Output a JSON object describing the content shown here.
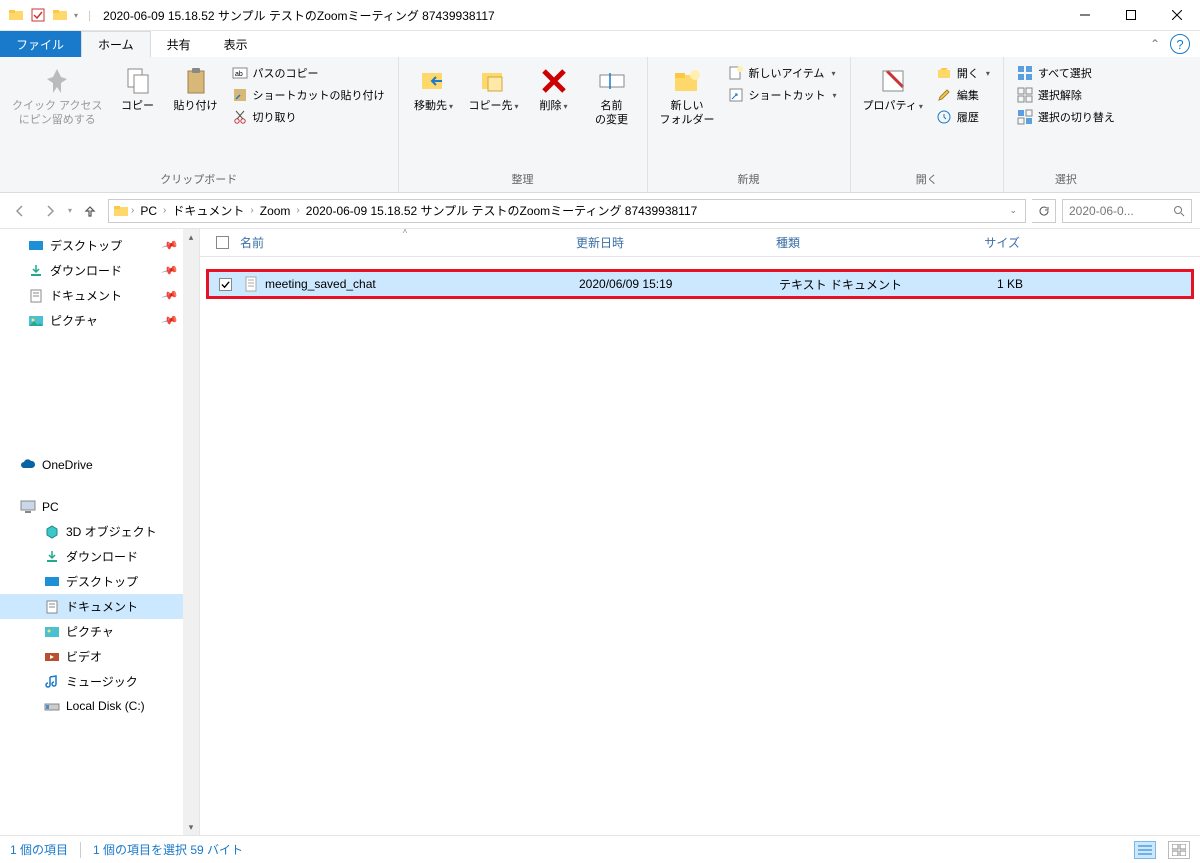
{
  "window": {
    "title": "2020-06-09 15.18.52 サンプル テストのZoomミーティング 87439938117"
  },
  "tabs": {
    "file": "ファイル",
    "home": "ホーム",
    "share": "共有",
    "view": "表示"
  },
  "ribbon": {
    "clipboard": {
      "quick_access": "クイック アクセス\nにピン留めする",
      "copy": "コピー",
      "paste": "貼り付け",
      "copy_path": "パスのコピー",
      "paste_shortcut": "ショートカットの貼り付け",
      "cut": "切り取り",
      "label": "クリップボード"
    },
    "organize": {
      "move_to": "移動先",
      "copy_to": "コピー先",
      "delete": "削除",
      "rename": "名前\nの変更",
      "label": "整理"
    },
    "new": {
      "new_folder": "新しい\nフォルダー",
      "new_item": "新しいアイテム",
      "shortcut": "ショートカット",
      "label": "新規"
    },
    "open": {
      "properties": "プロパティ",
      "open": "開く",
      "edit": "編集",
      "history": "履歴",
      "label": "開く"
    },
    "select": {
      "select_all": "すべて選択",
      "select_none": "選択解除",
      "invert": "選択の切り替え",
      "label": "選択"
    }
  },
  "breadcrumb": {
    "pc": "PC",
    "documents": "ドキュメント",
    "zoom": "Zoom",
    "folder": "2020-06-09 15.18.52 サンプル テストのZoomミーティング 87439938117"
  },
  "search": {
    "placeholder": "2020-06-0..."
  },
  "sidebar": {
    "quick": {
      "desktop": "デスクトップ",
      "downloads": "ダウンロード",
      "documents": "ドキュメント",
      "pictures": "ピクチャ"
    },
    "onedrive": "OneDrive",
    "pc": "PC",
    "pc_children": {
      "objects3d": "3D オブジェクト",
      "downloads": "ダウンロード",
      "desktop": "デスクトップ",
      "documents": "ドキュメント",
      "pictures": "ピクチャ",
      "videos": "ビデオ",
      "music": "ミュージック",
      "localdisk": "Local Disk (C:)"
    }
  },
  "columns": {
    "name": "名前",
    "modified": "更新日時",
    "type": "種類",
    "size": "サイズ"
  },
  "files": [
    {
      "name": "meeting_saved_chat",
      "modified": "2020/06/09 15:19",
      "type": "テキスト ドキュメント",
      "size": "1 KB"
    }
  ],
  "status": {
    "items": "1 個の項目",
    "selected": "1 個の項目を選択 59 バイト"
  }
}
